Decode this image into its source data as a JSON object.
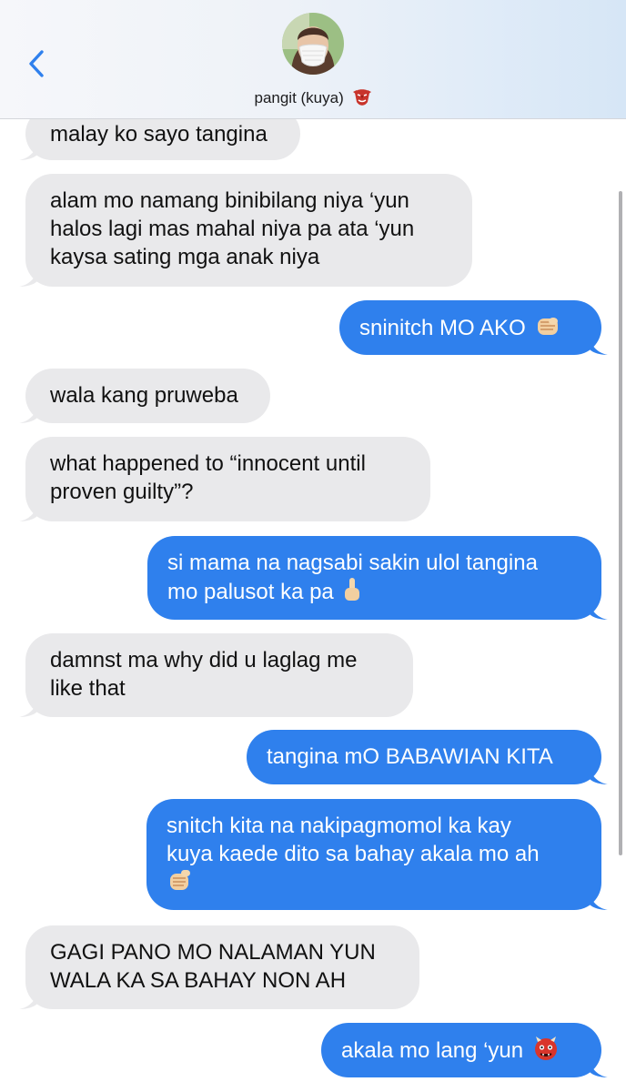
{
  "contact": {
    "name": "pangit (kuya)",
    "emoji": "goblin-mask-icon"
  },
  "messages": [
    {
      "from": "them",
      "lines": [
        "malay ko sayo tangina"
      ]
    },
    {
      "from": "them",
      "lines": [
        "alam mo namang binibilang niya ‘yun",
        "halos lagi mas mahal niya pa ata ‘yun",
        "kaysa sating mga anak niya"
      ]
    },
    {
      "from": "me",
      "lines": [
        "sninitch MO AKO"
      ],
      "emoji": "fist-emoji"
    },
    {
      "from": "them",
      "lines": [
        "wala kang pruweba"
      ]
    },
    {
      "from": "them",
      "lines": [
        "what happened to “innocent until",
        "proven guilty”?"
      ]
    },
    {
      "from": "me",
      "lines": [
        "si mama na nagsabi sakin ulol tangina",
        "mo palusot ka pa"
      ],
      "emoji": "middle-finger-emoji"
    },
    {
      "from": "them",
      "lines": [
        "damnst ma why did u laglag me",
        "like that"
      ]
    },
    {
      "from": "me",
      "lines": [
        "tangina mO BABAWIAN KITA"
      ]
    },
    {
      "from": "me",
      "lines": [
        "snitch kita na nakipagmomol ka kay",
        "kuya kaede dito sa bahay akala mo ah",
        ""
      ],
      "emoji": "pointing-fist-emoji"
    },
    {
      "from": "them",
      "lines": [
        "GAGI PANO MO NALAMAN YUN",
        "WALA KA SA BAHAY NON AH"
      ]
    },
    {
      "from": "me",
      "lines": [
        "akala mo lang ‘yun"
      ],
      "emoji": "ogre-emoji"
    }
  ],
  "colors": {
    "sent": "#2f80ed",
    "received": "#e9e9eb"
  }
}
